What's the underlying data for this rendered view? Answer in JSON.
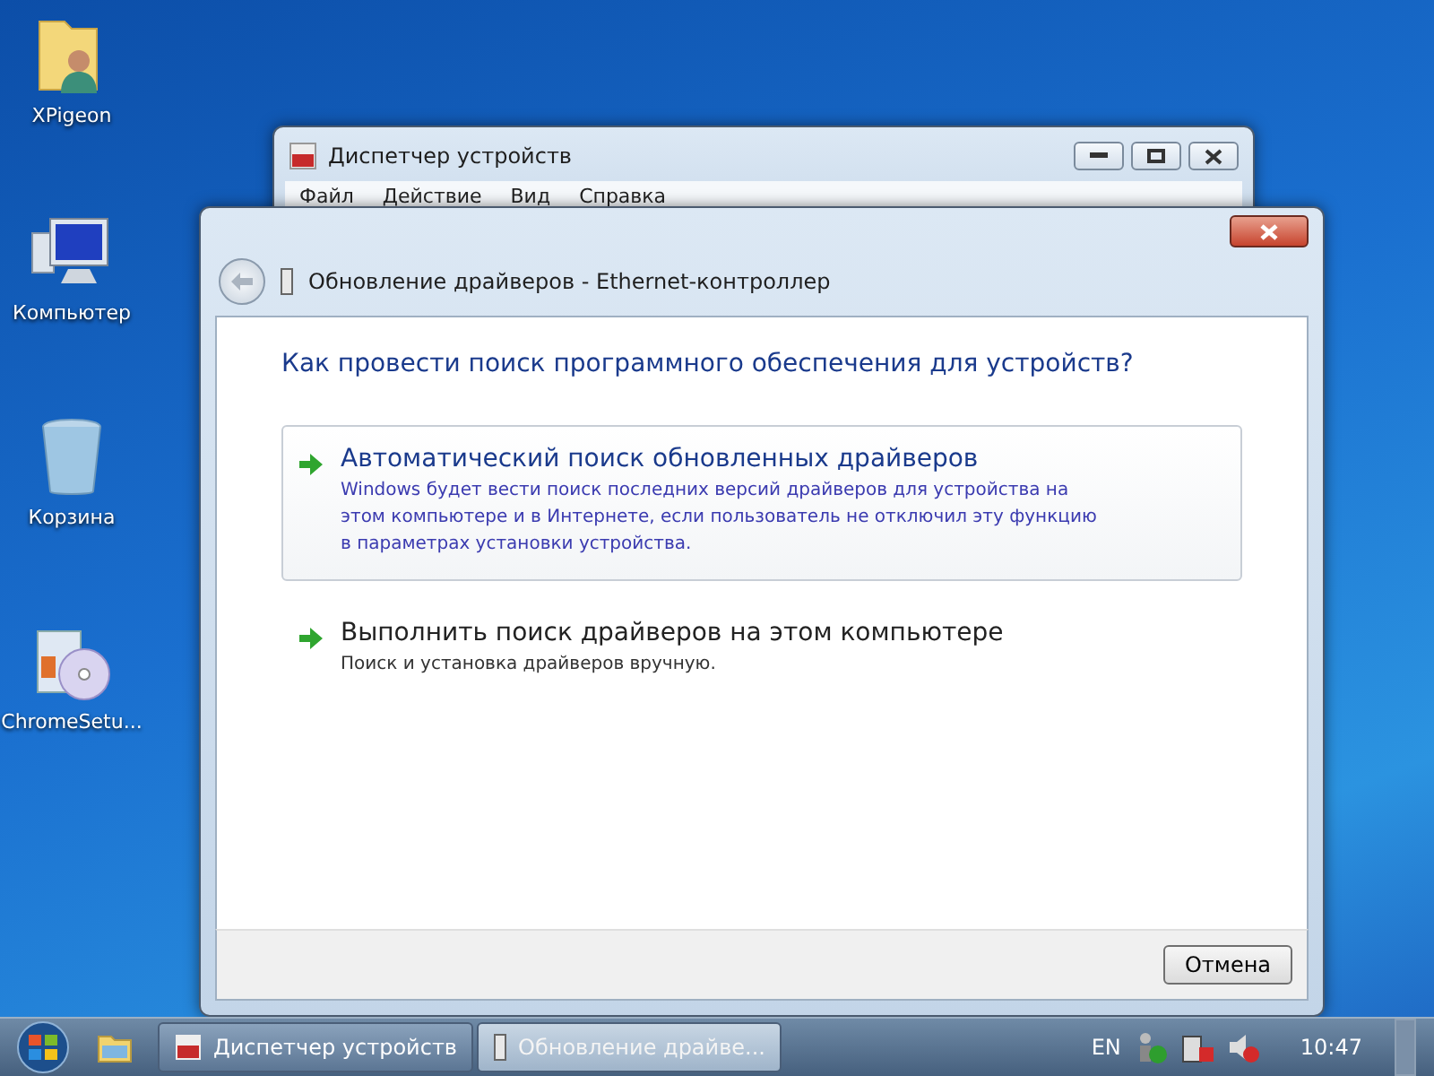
{
  "desktop_icons": [
    {
      "label": "XPigeon",
      "kind": "user-folder"
    },
    {
      "label": "Компьютер",
      "kind": "computer"
    },
    {
      "label": "Корзина",
      "kind": "recycle-bin"
    },
    {
      "label": "ChromeSetu...",
      "kind": "installer"
    }
  ],
  "back_window": {
    "title": "Диспетчер устройств",
    "menu": [
      "Файл",
      "Действие",
      "Вид",
      "Справка"
    ]
  },
  "dialog": {
    "title": "Обновление драйверов - Ethernet-контроллер",
    "question": "Как провести поиск программного обеспечения для устройств?",
    "options": [
      {
        "title": "Автоматический поиск обновленных драйверов",
        "description": "Windows будет вести поиск последних версий драйверов для устройства на этом компьютере и в Интернете, если пользователь не отключил эту функцию в параметрах установки устройства.",
        "selected": true
      },
      {
        "title": "Выполнить поиск драйверов на этом компьютере",
        "description": "Поиск и установка драйверов вручную.",
        "selected": false
      }
    ],
    "cancel_button": "Отмена"
  },
  "taskbar": {
    "buttons": [
      {
        "label": "Диспетчер устройств",
        "kind": "device-manager",
        "selected": false
      },
      {
        "label": "Обновление драйве...",
        "kind": "driver",
        "selected": true
      }
    ],
    "language": "EN",
    "clock": "10:47"
  }
}
